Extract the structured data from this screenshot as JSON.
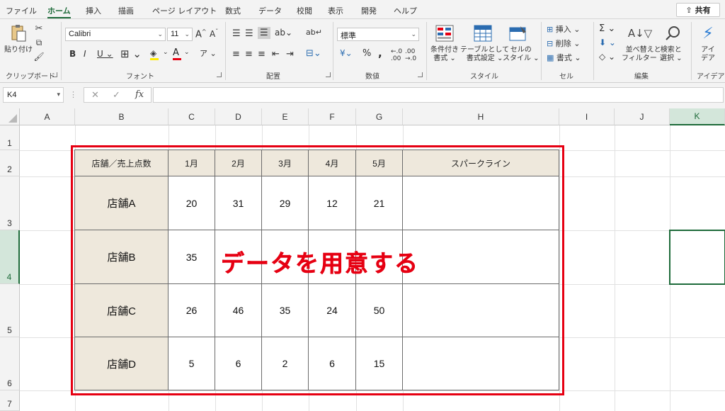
{
  "menu": {
    "tabs": [
      "ファイル",
      "ホーム",
      "挿入",
      "描画",
      "ページ レイアウト",
      "数式",
      "データ",
      "校閲",
      "表示",
      "開発",
      "ヘルプ"
    ],
    "share": "共有"
  },
  "ribbon": {
    "clipboard": {
      "paste": "貼り付け",
      "label": "クリップボード"
    },
    "font": {
      "name": "Calibri",
      "size": "11",
      "label": "フォント"
    },
    "alignment": {
      "label": "配置"
    },
    "number": {
      "format": "標準",
      "label": "数値"
    },
    "styles": {
      "conditional": "条件付き\n書式 ⌄",
      "table": "テーブルとして\n書式設定 ⌄",
      "cell": "セルの\nスタイル ⌄",
      "label": "スタイル"
    },
    "cells": {
      "insert": "挿入",
      "delete": "削除",
      "format": "書式",
      "label": "セル"
    },
    "editing": {
      "sort": "並べ替えと\nフィルター ⌄",
      "find": "検索と\n選択 ⌄",
      "label": "編集"
    },
    "ideas": {
      "btn": "アイ\nデア",
      "label": "アイデア"
    }
  },
  "formula_bar": {
    "name_box": "K4",
    "formula": ""
  },
  "sheet": {
    "columns": [
      "A",
      "B",
      "C",
      "D",
      "E",
      "F",
      "G",
      "H",
      "I",
      "J",
      "K"
    ],
    "rows": [
      "1",
      "2",
      "3",
      "4",
      "5",
      "6",
      "7"
    ],
    "selected_cell": "K4"
  },
  "table": {
    "headers": [
      "店舗／売上点数",
      "1月",
      "2月",
      "3月",
      "4月",
      "5月",
      "スパークライン"
    ],
    "rows": [
      {
        "store": "店舗A",
        "values": [
          "20",
          "31",
          "29",
          "12",
          "21"
        ]
      },
      {
        "store": "店舗B",
        "values": [
          "35",
          "",
          "",
          "",
          ""
        ]
      },
      {
        "store": "店舗C",
        "values": [
          "26",
          "46",
          "35",
          "24",
          "50"
        ]
      },
      {
        "store": "店舗D",
        "values": [
          "5",
          "6",
          "2",
          "6",
          "15"
        ]
      }
    ]
  },
  "annotation": {
    "text": "データを用意する",
    "color": "#e60012"
  }
}
